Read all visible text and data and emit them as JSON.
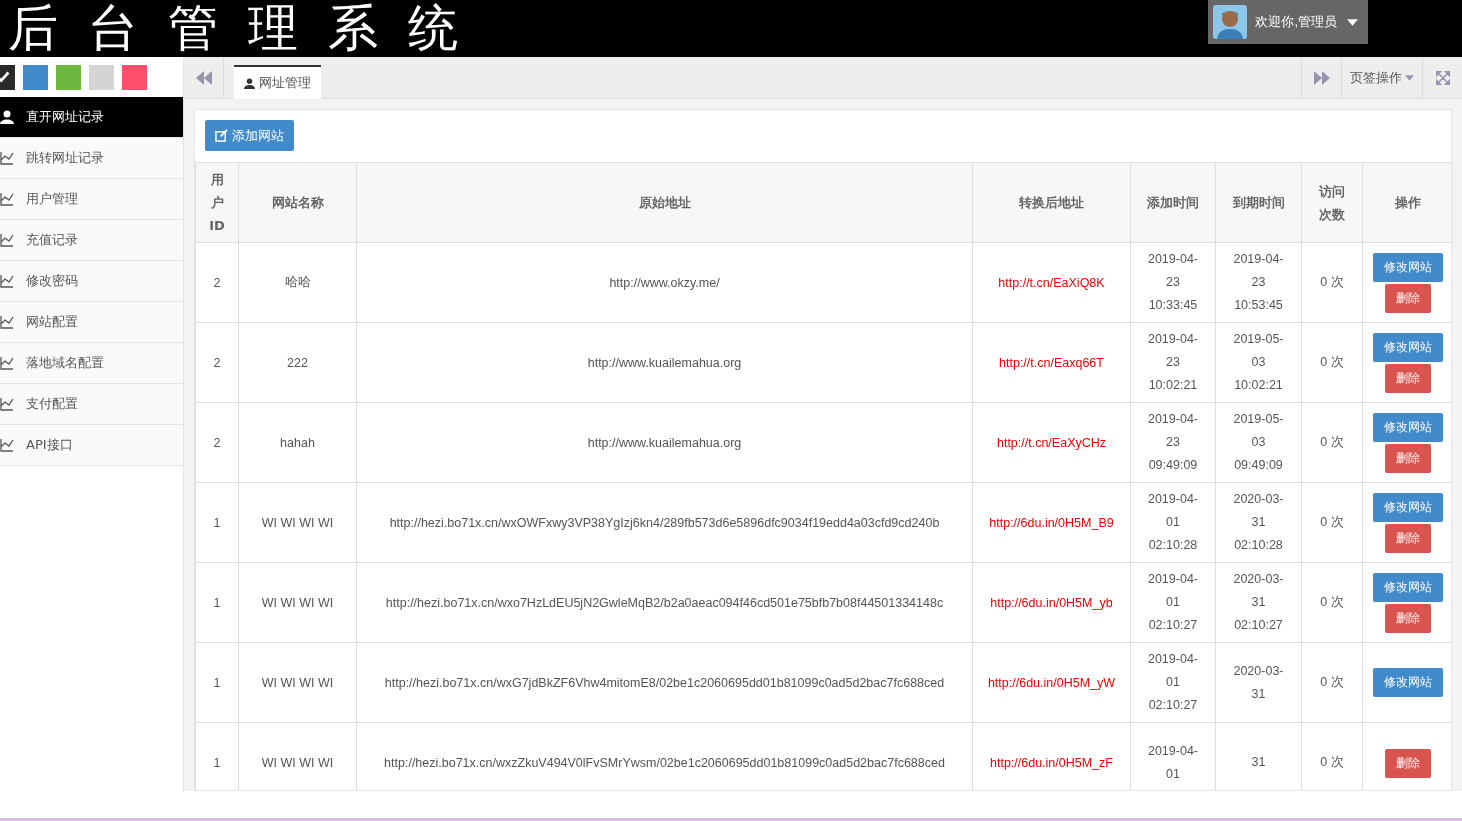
{
  "header": {
    "title": "后台管理系统",
    "user": {
      "greeting": "欢迎你,管理员"
    }
  },
  "theme_swatches": [
    {
      "color": "#2a2a2a",
      "selected": true
    },
    {
      "color": "#428bca",
      "selected": false
    },
    {
      "color": "#6fb83f",
      "selected": false
    },
    {
      "color": "#d4d4d4",
      "selected": false
    },
    {
      "color": "#ff4f6f",
      "selected": false
    }
  ],
  "sidebar": {
    "items": [
      {
        "label": "直开网址记录",
        "selected": true
      },
      {
        "label": "跳转网址记录",
        "selected": false
      },
      {
        "label": "用户管理",
        "selected": false
      },
      {
        "label": "充值记录",
        "selected": false
      },
      {
        "label": "修改密码",
        "selected": false
      },
      {
        "label": "网站配置",
        "selected": false
      },
      {
        "label": "落地域名配置",
        "selected": false
      },
      {
        "label": "支付配置",
        "selected": false
      },
      {
        "label": "API接口",
        "selected": false
      }
    ]
  },
  "tabs": [
    {
      "label": "网址管理",
      "selected": true
    }
  ],
  "tab_actions": {
    "label": "页签操作"
  },
  "add_button": "添加网站",
  "table": {
    "columns": [
      "用户ID",
      "网站名称",
      "原始地址",
      "转换后地址",
      "添加时间",
      "到期时间",
      "访问次数",
      "操作"
    ],
    "rows": [
      {
        "user_id": "2",
        "name": "哈哈",
        "original": "http://www.okzy.me/",
        "converted": "http://t.cn/EaXiQ8K",
        "added": "2019-04-23 10:33:45",
        "expires": "2019-04-23 10:53:45",
        "visits": "0 次",
        "actions": [
          {
            "kind": "edit",
            "label": "修改网站"
          },
          {
            "kind": "delete",
            "label": "删除"
          }
        ]
      },
      {
        "user_id": "2",
        "name": "222",
        "original": "http://www.kuailemahua.org",
        "converted": "http://t.cn/Eaxq66T",
        "added": "2019-04-23 10:02:21",
        "expires": "2019-05-03 10:02:21",
        "visits": "0 次",
        "actions": [
          {
            "kind": "edit",
            "label": "修改网站"
          },
          {
            "kind": "delete",
            "label": "删除"
          }
        ]
      },
      {
        "user_id": "2",
        "name": "hahah",
        "original": "http://www.kuailemahua.org",
        "converted": "http://t.cn/EaXyCHz",
        "added": "2019-04-23 09:49:09",
        "expires": "2019-05-03 09:49:09",
        "visits": "0 次",
        "actions": [
          {
            "kind": "edit",
            "label": "修改网站"
          },
          {
            "kind": "delete",
            "label": "删除"
          }
        ]
      },
      {
        "user_id": "1",
        "name": "WI WI WI WI",
        "original": "http://hezi.bo71x.cn/wxOWFxwy3VP38YgIzj6kn4/289fb573d6e5896dfc9034f19edd4a03cfd9cd240b",
        "converted": "http://6du.in/0H5M_B9",
        "added": "2019-04-01 02:10:28",
        "expires": "2020-03-31 02:10:28",
        "visits": "0 次",
        "actions": [
          {
            "kind": "edit",
            "label": "修改网站"
          },
          {
            "kind": "delete",
            "label": "删除"
          }
        ]
      },
      {
        "user_id": "1",
        "name": "WI WI WI WI",
        "original": "http://hezi.bo71x.cn/wxo7HzLdEU5jN2GwleMqB2/b2a0aeac094f46cd501e75bfb7b08f44501334148c",
        "converted": "http://6du.in/0H5M_yb",
        "added": "2019-04-01 02:10:27",
        "expires": "2020-03-31 02:10:27",
        "visits": "0 次",
        "actions": [
          {
            "kind": "edit",
            "label": "修改网站"
          },
          {
            "kind": "delete",
            "label": "删除"
          }
        ]
      },
      {
        "user_id": "1",
        "name": "WI WI WI WI",
        "original": "http://hezi.bo71x.cn/wxG7jdBkZF6Vhw4mitomE8/02be1c2060695dd01b81099c0ad5d2bac7fc688ced",
        "converted": "http://6du.in/0H5M_yW",
        "added": "2019-04-01 02:10:27",
        "expires": "2020-03-31",
        "visits": "0 次",
        "actions": [
          {
            "kind": "edit",
            "label": "修改网站"
          }
        ]
      },
      {
        "user_id": "1",
        "name": "WI WI WI WI",
        "original": "http://hezi.bo71x.cn/wxzZkuV494V0lFvSMrYwsm/02be1c2060695dd01b81099c0ad5d2bac7fc688ced",
        "converted": "http://6du.in/0H5M_zF",
        "added": "2019-04-01",
        "expires": "31",
        "visits": "0 次",
        "actions": [
          {
            "kind": "delete",
            "label": "删除"
          }
        ]
      }
    ]
  }
}
